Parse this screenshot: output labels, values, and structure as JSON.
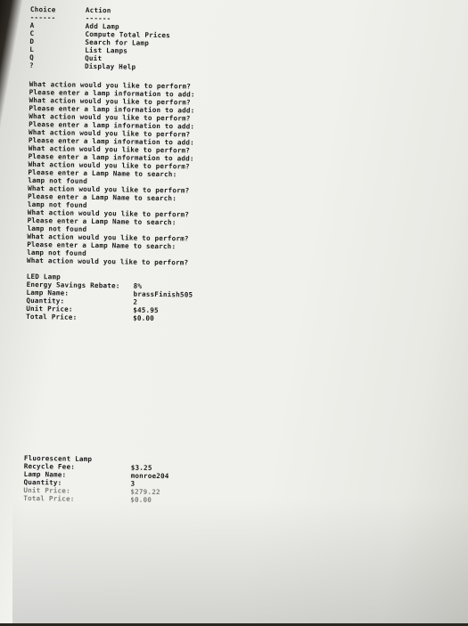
{
  "menu": {
    "header_choice": "Choice",
    "header_action": "Action",
    "divider_choice": "------",
    "divider_action": "------",
    "items": [
      {
        "choice": "A",
        "action": "Add Lamp"
      },
      {
        "choice": "C",
        "action": "Compute Total Prices"
      },
      {
        "choice": "D",
        "action": "Search for Lamp"
      },
      {
        "choice": "L",
        "action": "List Lamps"
      },
      {
        "choice": "Q",
        "action": "Quit"
      },
      {
        "choice": "?",
        "action": "Display Help"
      }
    ]
  },
  "session": [
    "What action would you like to perform?",
    "Please enter a lamp information to add:",
    "What action would you like to perform?",
    "Please enter a lamp information to add:",
    "What action would you like to perform?",
    "Please enter a lamp information to add:",
    "What action would you like to perform?",
    "Please enter a lamp information to add:",
    "What action would you like to perform?",
    "Please enter a lamp information to add:",
    "What action would you like to perform?",
    "Please enter a Lamp Name to search:",
    "lamp not found",
    "What action would you like to perform?",
    "Please enter a Lamp Name to search:",
    "lamp not found",
    "What action would you like to perform?",
    "Please enter a Lamp Name to search:",
    "lamp not found",
    "What action would you like to perform?",
    "Please enter a Lamp Name to search:",
    "lamp not found",
    "What action would you like to perform?"
  ],
  "led_lamp": {
    "title": "LED Lamp",
    "rows": [
      {
        "label": "Energy Savings Rebate:",
        "value": "8%"
      },
      {
        "label": "Lamp Name:",
        "value": "brassFinish505"
      },
      {
        "label": "Quantity:",
        "value": "2"
      },
      {
        "label": "Unit Price:",
        "value": "$45.95"
      },
      {
        "label": "Total Price:",
        "value": "$0.00"
      }
    ]
  },
  "fluorescent_lamp": {
    "title": "Fluorescent Lamp",
    "rows": [
      {
        "label": "Recycle Fee:",
        "value": "$3.25"
      },
      {
        "label": "Lamp Name:",
        "value": "monroe204"
      },
      {
        "label": "Quantity:",
        "value": "3"
      },
      {
        "label": "Unit Price:",
        "value": "$279.22"
      },
      {
        "label": "Total Price:",
        "value": "$0.00"
      }
    ]
  }
}
